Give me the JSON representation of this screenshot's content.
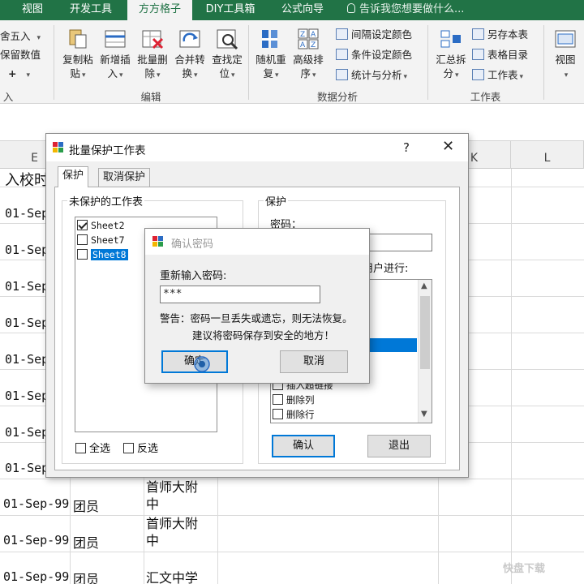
{
  "ribbon_tabs": [
    {
      "label": "视图",
      "active": false
    },
    {
      "label": "开发工具",
      "active": false
    },
    {
      "label": "方方格子",
      "active": true
    },
    {
      "label": "DIY工具箱",
      "active": false
    },
    {
      "label": "公式向导",
      "active": false
    }
  ],
  "tell_me": "告诉我您想要做什么...",
  "ribbon": {
    "left_partial": {
      "round": "舍五入",
      "keep_value": "保留数值",
      "plus": "+",
      "group_tail": "入"
    },
    "edit_group": {
      "label": "编辑",
      "buttons": [
        {
          "line1": "复制粘",
          "line2": "贴",
          "icon": "copy-paste-icon"
        },
        {
          "line1": "新增插",
          "line2": "入",
          "icon": "insert-icon"
        },
        {
          "line1": "批量删",
          "line2": "除",
          "icon": "batch-delete-icon"
        },
        {
          "line1": "合并转",
          "line2": "换",
          "icon": "merge-convert-icon"
        },
        {
          "line1": "查找定",
          "line2": "位",
          "icon": "find-locate-icon"
        }
      ]
    },
    "analysis_group": {
      "label": "数据分析",
      "buttons": [
        {
          "line1": "随机重",
          "line2": "复",
          "icon": "random-icon"
        },
        {
          "line1": "高级排",
          "line2": "序",
          "icon": "sort-icon"
        }
      ],
      "small": [
        "间隔设定颜色",
        "条件设定颜色",
        "统计与分析"
      ]
    },
    "sheet_group": {
      "label": "工作表",
      "buttons": [
        {
          "line1": "汇总拆",
          "line2": "分",
          "icon": "summary-split-icon"
        }
      ],
      "small": [
        "另存本表",
        "表格目录",
        "工作表"
      ]
    },
    "view_group": {
      "label": "视图"
    }
  },
  "sheet": {
    "columns": [
      "E",
      "K",
      "L"
    ],
    "header_row": [
      "入校时"
    ],
    "rows": [
      {
        "date": "01-Sep"
      },
      {
        "date": "01-Sep"
      },
      {
        "date": "01-Sep"
      },
      {
        "date": "01-Sep"
      },
      {
        "date": "01-Sep"
      },
      {
        "date": "01-Sep"
      },
      {
        "date": "01-Sep"
      },
      {
        "date": "01-Sep"
      },
      {
        "date": "01-Sep-99",
        "status": "团员",
        "school": "首师大附中"
      },
      {
        "date": "01-Sep-99",
        "status": "团员",
        "school": "首师大附中"
      },
      {
        "date": "01-Sep-99",
        "status": "团员",
        "school": "汇文中学"
      }
    ],
    "school_lines": [
      [
        "首师大附",
        "中"
      ],
      [
        "首师大附",
        "中"
      ],
      [
        "汇文中学"
      ]
    ]
  },
  "dialog": {
    "title": "批量保护工作表",
    "help": "?",
    "close": "✕",
    "tabs": [
      "保护",
      "取消保护"
    ],
    "unprotected_label": "未保护的工作表",
    "sheets": [
      {
        "name": "Sheet2",
        "checked": true,
        "selected": false
      },
      {
        "name": "Sheet7",
        "checked": false,
        "selected": false
      },
      {
        "name": "Sheet8",
        "checked": false,
        "selected": true
      }
    ],
    "select_all": "全选",
    "invert": "反选",
    "protect_label": "保护",
    "password_label": "密码：",
    "allow_users_partial": "用户进行:",
    "permissions_visible": [
      "插入超链接",
      "删除列",
      "删除行"
    ],
    "ok": "确认",
    "exit": "退出"
  },
  "confirm": {
    "title": "确认密码",
    "reenter_label": "重新输入密码:",
    "password_value": "***",
    "warning_line1": "警告：密码一旦丢失或遗忘，则无法恢复。",
    "warning_line2": "建议将密码保存到安全的地方！",
    "ok": "确定",
    "cancel": "取消"
  },
  "watermark": "快盘下载"
}
